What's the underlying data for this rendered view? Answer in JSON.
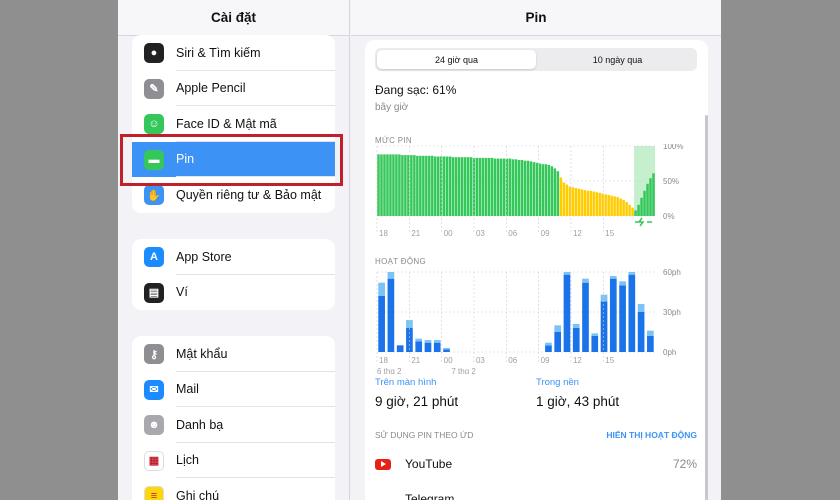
{
  "sidebar": {
    "title": "Cài đặt",
    "group1": [
      {
        "label": "Siri & Tìm kiếm",
        "icon": "siri-icon",
        "color": "#222"
      },
      {
        "label": "Apple Pencil",
        "icon": "pencil-icon",
        "color": "#8e8e93"
      },
      {
        "label": "Face ID & Mật mã",
        "icon": "faceid-icon",
        "color": "#34c759"
      },
      {
        "label": "Pin",
        "icon": "battery-icon",
        "color": "#34c759",
        "selected": true
      },
      {
        "label": "Quyền riêng tư & Bảo mật",
        "icon": "hand-icon",
        "color": "#3c93f5"
      }
    ],
    "group2": [
      {
        "label": "App Store",
        "icon": "appstore-icon",
        "color": "#1a8cff"
      },
      {
        "label": "Ví",
        "icon": "wallet-icon",
        "color": "#222"
      }
    ],
    "group3": [
      {
        "label": "Mật khẩu",
        "icon": "key-icon",
        "color": "#8e8e93"
      },
      {
        "label": "Mail",
        "icon": "mail-icon",
        "color": "#1a8cff"
      },
      {
        "label": "Danh bạ",
        "icon": "contacts-icon",
        "color": "#a8a8ad"
      },
      {
        "label": "Lịch",
        "icon": "calendar-icon",
        "color": "#fff"
      },
      {
        "label": "Ghi chú",
        "icon": "notes-icon",
        "color": "#ffd60a"
      }
    ]
  },
  "detail": {
    "title": "Pin",
    "tabs": [
      "24 giờ qua",
      "10 ngày qua"
    ],
    "charging": "Đang sạc: 61%",
    "charging_sub": "bây giờ",
    "battery_label": "MỨC PIN",
    "activity_label": "HOẠT ĐỘNG",
    "battery_y_ticks": [
      "100%",
      "50%",
      "0%"
    ],
    "activity_y_ticks": [
      "60ph",
      "30ph",
      "0ph"
    ],
    "x_ticks": [
      "18",
      "21",
      "00",
      "03",
      "06",
      "09",
      "12",
      "15"
    ],
    "date_labels": [
      "6 thg 2",
      "7 thg 2"
    ],
    "screen_on_label": "Trên màn hình",
    "screen_on_value": "9 giờ, 21 phút",
    "background_label": "Trong nền",
    "background_value": "1 giờ, 43 phút",
    "usage_label": "SỬ DỤNG PIN THEO ỨD",
    "show_activity": "HIỂN THỊ HOẠT ĐỘNG",
    "apps": [
      {
        "name": "YouTube",
        "pct": "72%"
      },
      {
        "name": "Telegram",
        "pct": ""
      }
    ]
  },
  "chart_data": [
    {
      "type": "bar",
      "title": "MỨC PIN",
      "ylim": [
        0,
        100
      ],
      "colors": {
        "normal": "#34c759",
        "low_power": "#ffcc00",
        "charging_bg": "#c6efce"
      },
      "levels": [
        88,
        88,
        88,
        88,
        88,
        88,
        88,
        88,
        87,
        87,
        87,
        87,
        87,
        86,
        86,
        86,
        86,
        86,
        86,
        85,
        85,
        85,
        85,
        85,
        85,
        84,
        84,
        84,
        84,
        84,
        84,
        84,
        83,
        83,
        83,
        83,
        83,
        83,
        83,
        82,
        82,
        82,
        82,
        82,
        82,
        81,
        81,
        80,
        80,
        79,
        79,
        78,
        77,
        76,
        75,
        74,
        74,
        73,
        71,
        68,
        64,
        55,
        48,
        45,
        42,
        41,
        40,
        39,
        38,
        37,
        36,
        36,
        35,
        34,
        33,
        32,
        31,
        30,
        29,
        28,
        27,
        25,
        23,
        20,
        16,
        12,
        8,
        16,
        26,
        36,
        46,
        54,
        61
      ],
      "low_power_from": 61,
      "charging_from": 86
    },
    {
      "type": "bar",
      "title": "HOẠT ĐỘNG",
      "ylim": [
        0,
        60
      ],
      "series": [
        {
          "name": "Trên màn hình",
          "color": "#1a73e8",
          "values": [
            42,
            55,
            5,
            18,
            8,
            7,
            7,
            2,
            0,
            0,
            0,
            0,
            0,
            0,
            0,
            0,
            0,
            0,
            5,
            15,
            58,
            18,
            52,
            12,
            38,
            55,
            50,
            58,
            30,
            12
          ]
        },
        {
          "name": "Trong nền",
          "color": "#7cc3f5",
          "values": [
            10,
            5,
            0,
            6,
            2,
            2,
            2,
            1,
            0,
            0,
            0,
            0,
            0,
            0,
            0,
            0,
            0,
            0,
            2,
            5,
            2,
            3,
            3,
            2,
            5,
            2,
            3,
            2,
            6,
            4
          ]
        }
      ]
    }
  ]
}
